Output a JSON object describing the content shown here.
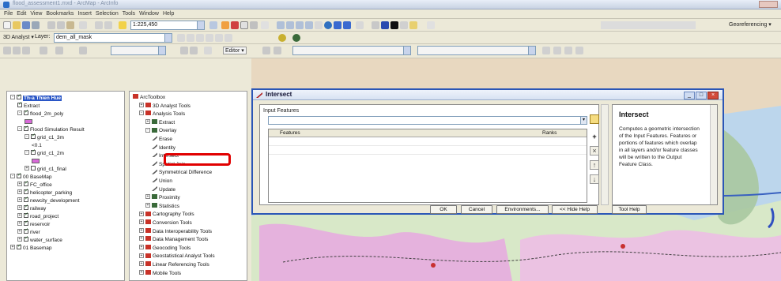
{
  "window": {
    "title": "flood_assessment1.mxd - ArcMap - ArcInfo"
  },
  "menu": [
    "File",
    "Edit",
    "View",
    "Bookmarks",
    "Insert",
    "Selection",
    "Tools",
    "Window",
    "Help"
  ],
  "toolbar": {
    "scale_value": "1:225,450",
    "georeferencing_label": "Georeferencing ▾",
    "analyst_label": "3D Analyst ▾",
    "layer_label": "Layer:",
    "layer_value": "dem_all_mask",
    "editor_label": "Editor ▾"
  },
  "toc": {
    "items": [
      {
        "label": "Th-a Thien Hue",
        "level": 0,
        "expand": "-",
        "checked": true,
        "bold": true
      },
      {
        "label": "Extract",
        "level": 1,
        "checked": true
      },
      {
        "label": "flood_2m_poly",
        "level": 1,
        "expand": "-",
        "checked": true
      },
      {
        "label": "",
        "level": 2,
        "swatch": "#d86ad8"
      },
      {
        "label": "Flood Simulation Result",
        "level": 1,
        "expand": "-",
        "checked": true
      },
      {
        "label": "grid_c1_3m",
        "level": 2,
        "expand": "-",
        "checked": true
      },
      {
        "label": "<0.1",
        "level": 3
      },
      {
        "label": "grid_c1_2m",
        "level": 2,
        "expand": "-",
        "checked": true
      },
      {
        "label": "",
        "level": 3,
        "swatch": "#d86ad8"
      },
      {
        "label": "grid_c1_final",
        "level": 2,
        "expand": "+",
        "checked": false
      },
      {
        "label": "00 BaseMap",
        "level": 0,
        "expand": "-",
        "checked": true
      },
      {
        "label": "FC_office",
        "level": 1,
        "expand": "+",
        "checked": true
      },
      {
        "label": "helicopter_parking",
        "level": 1,
        "expand": "+",
        "checked": true
      },
      {
        "label": "newcity_development",
        "level": 1,
        "expand": "+",
        "checked": true
      },
      {
        "label": "railway",
        "level": 1,
        "expand": "+",
        "checked": true
      },
      {
        "label": "road_project",
        "level": 1,
        "expand": "+",
        "checked": true
      },
      {
        "label": "reservoir",
        "level": 1,
        "expand": "+",
        "checked": true
      },
      {
        "label": "river",
        "level": 1,
        "expand": "+",
        "checked": true
      },
      {
        "label": "water_surface",
        "level": 1,
        "expand": "+",
        "checked": true
      },
      {
        "label": "01 Basemap",
        "level": 0,
        "expand": "+",
        "checked": true
      }
    ]
  },
  "toolbox": {
    "items": [
      {
        "label": "ArcToolbox",
        "level": 0,
        "icon": "toolbox"
      },
      {
        "label": "3D Analyst Tools",
        "level": 1,
        "expand": "+",
        "icon": "toolbox"
      },
      {
        "label": "Analysis Tools",
        "level": 1,
        "expand": "-",
        "icon": "toolbox"
      },
      {
        "label": "Extract",
        "level": 2,
        "expand": "+",
        "icon": "toolset"
      },
      {
        "label": "Overlay",
        "level": 2,
        "expand": "-",
        "icon": "toolset"
      },
      {
        "label": "Erase",
        "level": 3,
        "icon": "tool"
      },
      {
        "label": "Identity",
        "level": 3,
        "icon": "tool"
      },
      {
        "label": "Intersect",
        "level": 3,
        "icon": "tool",
        "highlighted": true
      },
      {
        "label": "Spatial Join",
        "level": 3,
        "icon": "tool"
      },
      {
        "label": "Symmetrical Difference",
        "level": 3,
        "icon": "tool"
      },
      {
        "label": "Union",
        "level": 3,
        "icon": "tool"
      },
      {
        "label": "Update",
        "level": 3,
        "icon": "tool"
      },
      {
        "label": "Proximity",
        "level": 2,
        "expand": "+",
        "icon": "toolset"
      },
      {
        "label": "Statistics",
        "level": 2,
        "expand": "+",
        "icon": "toolset"
      },
      {
        "label": "Cartography Tools",
        "level": 1,
        "expand": "+",
        "icon": "toolbox"
      },
      {
        "label": "Conversion Tools",
        "level": 1,
        "expand": "+",
        "icon": "toolbox"
      },
      {
        "label": "Data Interoperability Tools",
        "level": 1,
        "expand": "+",
        "icon": "toolbox"
      },
      {
        "label": "Data Management Tools",
        "level": 1,
        "expand": "+",
        "icon": "toolbox"
      },
      {
        "label": "Geocoding Tools",
        "level": 1,
        "expand": "+",
        "icon": "toolbox"
      },
      {
        "label": "Geostatistical Analyst Tools",
        "level": 1,
        "expand": "+",
        "icon": "toolbox"
      },
      {
        "label": "Linear Referencing Tools",
        "level": 1,
        "expand": "+",
        "icon": "toolbox"
      },
      {
        "label": "Mobile Tools",
        "level": 1,
        "expand": "+",
        "icon": "toolbox"
      }
    ]
  },
  "dialog": {
    "title": "Intersect",
    "input_label": "Input Features",
    "table_headers": {
      "features": "Features",
      "ranks": "Ranks"
    },
    "help_title": "Intersect",
    "help_text": "Computes a geometric intersection of the Input Features. Features or portions of features which overlap in all layers and/or feature classes will be written to the Output Feature Class.",
    "buttons": {
      "ok": "OK",
      "cancel": "Cancel",
      "environments": "Environments...",
      "hide_help": "<< Hide Help",
      "tool_help": "Tool Help"
    }
  },
  "colors": {
    "highlight": "#e10000",
    "dialog_border": "#2b56b6",
    "map_water": "#bcd6ec"
  }
}
